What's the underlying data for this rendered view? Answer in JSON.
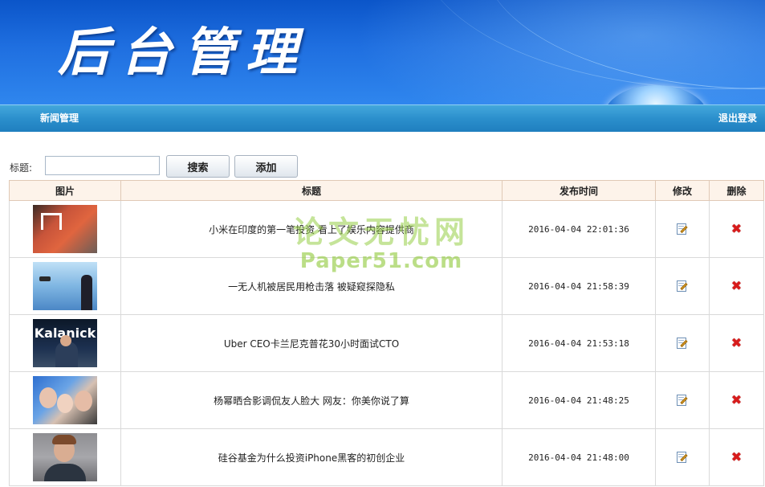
{
  "header": {
    "title": "后台管理"
  },
  "nav": {
    "left_item": "新闻管理",
    "logout": "退出登录"
  },
  "search": {
    "label": "标题:",
    "value": "",
    "search_button": "搜索",
    "add_button": "添加"
  },
  "table": {
    "columns": [
      "图片",
      "标题",
      "发布时间",
      "修改",
      "删除"
    ],
    "rows": [
      {
        "title": "小米在印度的第一笔投资 看上了娱乐内容提供商",
        "time": "2016-04-04 22:01:36",
        "thumb_icon": "xiaomi-photo"
      },
      {
        "title": "一无人机被居民用枪击落 被疑窥探隐私",
        "time": "2016-04-04 21:58:39",
        "thumb_icon": "drone-photo"
      },
      {
        "title": "Uber CEO卡兰尼克普花30小时面试CTO",
        "time": "2016-04-04 21:53:18",
        "thumb_icon": "uber-ceo-photo",
        "thumb_text": "Kalanick"
      },
      {
        "title": "杨幂晒合影调侃友人脸大 网友：你美你说了算",
        "time": "2016-04-04 21:48:25",
        "thumb_icon": "group-selfie-photo"
      },
      {
        "title": "硅谷基金为什么投资iPhone黑客的初创企业",
        "time": "2016-04-04 21:48:00",
        "thumb_icon": "portrait-photo"
      }
    ]
  },
  "watermark": {
    "line1": "论文无忧网",
    "line2": "Paper51.com"
  },
  "colors": {
    "banner": "#1f6fe0",
    "navbar": "#2b8fcc",
    "table_header_bg": "#fdf3ea",
    "delete": "#d81b1b"
  }
}
